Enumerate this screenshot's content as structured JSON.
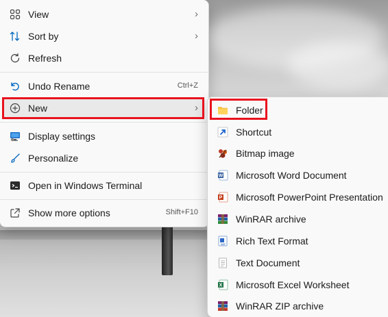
{
  "context_menu": {
    "items": [
      {
        "label": "View",
        "icon": "view-grid-icon"
      },
      {
        "label": "Sort by",
        "icon": "sort-icon"
      },
      {
        "label": "Refresh",
        "icon": "refresh-icon"
      },
      {
        "label": "Undo Rename",
        "shortcut": "Ctrl+Z",
        "icon": "undo-icon"
      },
      {
        "label": "New",
        "icon": "add-circle-icon"
      },
      {
        "label": "Display settings",
        "icon": "display-icon"
      },
      {
        "label": "Personalize",
        "icon": "brush-icon"
      },
      {
        "label": "Open in Windows Terminal",
        "icon": "terminal-icon"
      },
      {
        "label": "Show more options",
        "shortcut": "Shift+F10",
        "icon": "share-icon"
      }
    ]
  },
  "new_submenu": {
    "items": [
      {
        "label": "Folder",
        "icon": "folder-icon"
      },
      {
        "label": "Shortcut",
        "icon": "shortcut-arrow-icon"
      },
      {
        "label": "Bitmap image",
        "icon": "paint-icon"
      },
      {
        "label": "Microsoft Word Document",
        "icon": "word-icon"
      },
      {
        "label": "Microsoft PowerPoint Presentation",
        "icon": "powerpoint-icon"
      },
      {
        "label": "WinRAR archive",
        "icon": "winrar-icon"
      },
      {
        "label": "Rich Text Format",
        "icon": "wordpad-icon"
      },
      {
        "label": "Text Document",
        "icon": "text-file-icon"
      },
      {
        "label": "Microsoft Excel Worksheet",
        "icon": "excel-icon"
      },
      {
        "label": "WinRAR ZIP archive",
        "icon": "winrar-zip-icon"
      }
    ]
  },
  "colors": {
    "highlight_box": "#e8121e",
    "accent": "#0067c0",
    "menu_bg": "#f9f9f9"
  }
}
